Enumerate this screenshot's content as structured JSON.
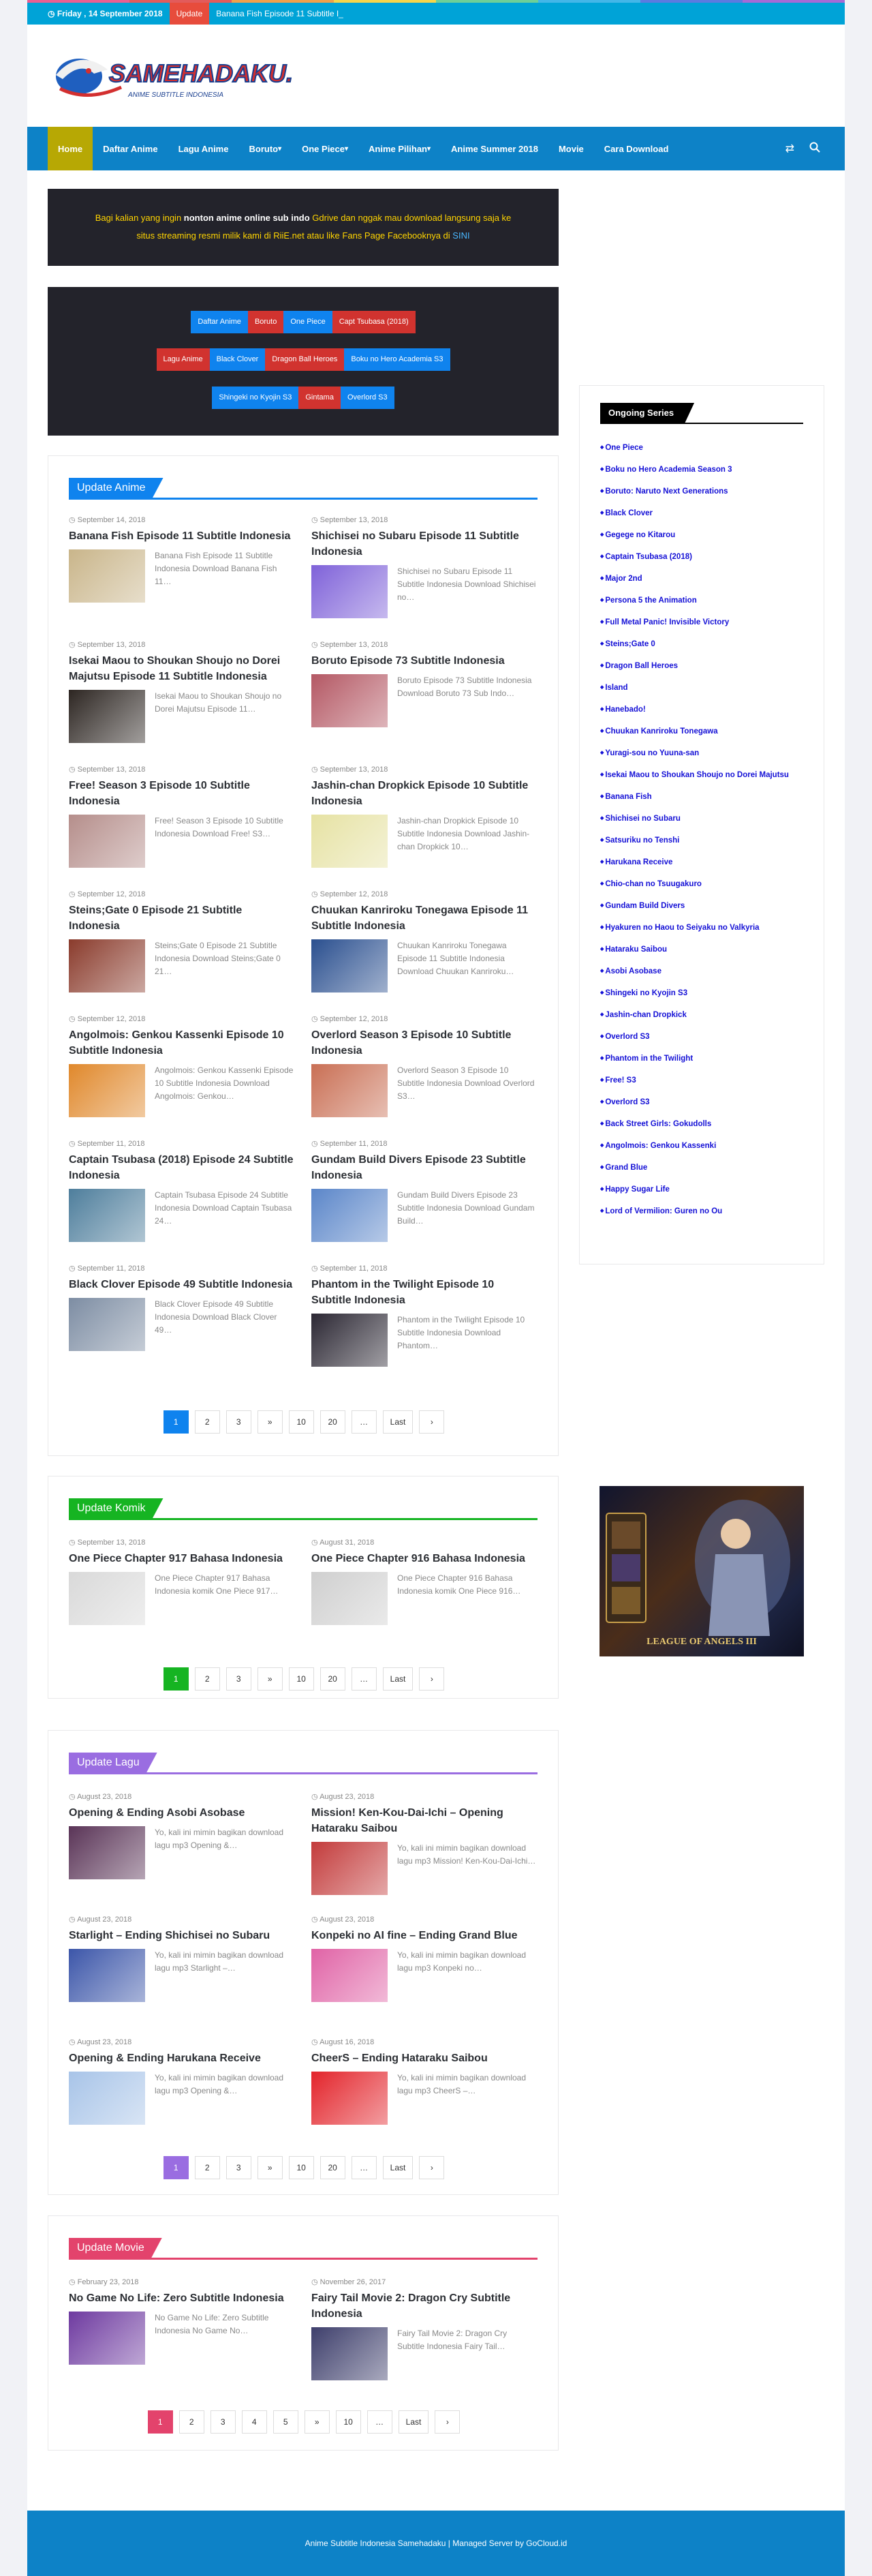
{
  "topbar": {
    "date": "Friday , 14 September 2018",
    "update_label": "Update",
    "ticker": "Banana Fish Episode 11 Subtitle I_"
  },
  "logo": {
    "text": "SAMEHADAKU.TV",
    "tagline": "ANIME SUBTITLE INDONESIA"
  },
  "nav": {
    "items": [
      "Home",
      "Daftar Anime",
      "Lagu Anime",
      "Boruto",
      "One Piece",
      "Anime Pilihan",
      "Anime Summer 2018",
      "Movie",
      "Cara Download"
    ],
    "dropdown": [
      false,
      false,
      false,
      true,
      true,
      true,
      false,
      false,
      false
    ]
  },
  "notice": {
    "line1_pre": "Bagi kalian yang ingin ",
    "line1_bold": "nonton anime online sub indo",
    "line1_post": " Gdrive dan nggak mau download langsung saja ke",
    "line2_pre": "situs streaming resmi milik kami di RiiE.net atau like Fans Page Facebooknya di ",
    "line2_link": "SINI"
  },
  "quick_links": [
    [
      {
        "label": "Daftar Anime",
        "c": "blue"
      },
      {
        "label": "Boruto",
        "c": "red"
      },
      {
        "label": "One Piece",
        "c": "blue"
      },
      {
        "label": "Capt Tsubasa (2018)",
        "c": "red"
      }
    ],
    [
      {
        "label": "Lagu Anime",
        "c": "red"
      },
      {
        "label": "Black Clover",
        "c": "blue"
      },
      {
        "label": "Dragon Ball Heroes",
        "c": "red"
      },
      {
        "label": "Boku no Hero Academia S3",
        "c": "blue"
      }
    ],
    [
      {
        "label": "Shingeki no Kyojin S3",
        "c": "blue"
      },
      {
        "label": "Gintama",
        "c": "red"
      },
      {
        "label": "Overlord S3",
        "c": "blue"
      }
    ]
  ],
  "sections": {
    "anime": {
      "title": "Update Anime",
      "color": "#0f83ee",
      "posts": [
        {
          "date": "September 14, 2018",
          "title": "Banana Fish Episode 11 Subtitle Indonesia",
          "excerpt": "Banana Fish Episode 11 Subtitle Indonesia Download Banana Fish 11…",
          "thumb": "#c9b58a"
        },
        {
          "date": "September 13, 2018",
          "title": "Shichisei no Subaru Episode 11 Subtitle Indonesia",
          "excerpt": "Shichisei no Subaru Episode 11 Subtitle Indonesia Download Shichisei no…",
          "thumb": "#7f62d9"
        },
        {
          "date": "September 13, 2018",
          "title": "Isekai Maou to Shoukan Shoujo no Dorei Majutsu Episode 11 Subtitle Indonesia",
          "excerpt": "Isekai Maou to Shoukan Shoujo no Dorei Majutsu Episode 11…",
          "thumb": "#2d2622"
        },
        {
          "date": "September 13, 2018",
          "title": "Boruto Episode 73 Subtitle Indonesia",
          "excerpt": "Boruto Episode 73 Subtitle Indonesia Download Boruto 73 Sub Indo…",
          "thumb": "#b45864"
        },
        {
          "date": "September 13, 2018",
          "title": "Free! Season 3 Episode 10 Subtitle Indonesia",
          "excerpt": "Free! Season 3 Episode 10 Subtitle Indonesia Download Free! S3…",
          "thumb": "#b58e8b"
        },
        {
          "date": "September 13, 2018",
          "title": "Jashin-chan Dropkick Episode 10 Subtitle Indonesia",
          "excerpt": "Jashin-chan Dropkick Episode 10 Subtitle Indonesia Download Jashin-chan Dropkick 10…",
          "thumb": "#e6e2a3"
        },
        {
          "date": "September 12, 2018",
          "title": "Steins;Gate 0 Episode 21 Subtitle Indonesia",
          "excerpt": "Steins;Gate 0 Episode 21 Subtitle Indonesia Download Steins;Gate 0 21…",
          "thumb": "#8a3b2c"
        },
        {
          "date": "September 12, 2018",
          "title": "Chuukan Kanriroku Tonegawa Episode 11 Subtitle Indonesia",
          "excerpt": "Chuukan Kanriroku Tonegawa Episode 11 Subtitle Indonesia Download Chuukan Kanriroku…",
          "thumb": "#2a4f8f"
        },
        {
          "date": "September 12, 2018",
          "title": "Angolmois: Genkou Kassenki Episode 10 Subtitle Indonesia",
          "excerpt": "Angolmois: Genkou Kassenki Episode 10 Subtitle Indonesia Download Angolmois: Genkou…",
          "thumb": "#e0882b"
        },
        {
          "date": "September 12, 2018",
          "title": "Overlord Season 3 Episode 10 Subtitle Indonesia",
          "excerpt": "Overlord Season 3 Episode 10 Subtitle Indonesia Download Overlord S3…",
          "thumb": "#c96f54"
        },
        {
          "date": "September 11, 2018",
          "title": "Captain Tsubasa (2018) Episode 24 Subtitle Indonesia",
          "excerpt": "Captain Tsubasa Episode 24 Subtitle Indonesia Download Captain Tsubasa 24…",
          "thumb": "#4e7e9c"
        },
        {
          "date": "September 11, 2018",
          "title": "Gundam Build Divers Episode 23 Subtitle Indonesia",
          "excerpt": "Gundam Build Divers Episode 23 Subtitle Indonesia Download Gundam Build…",
          "thumb": "#5b86c9"
        },
        {
          "date": "September 11, 2018",
          "title": "Black Clover Episode 49 Subtitle Indonesia",
          "excerpt": "Black Clover Episode 49 Subtitle Indonesia Download Black Clover 49…",
          "thumb": "#7d8da3"
        },
        {
          "date": "September 11, 2018",
          "title": "Phantom in the Twilight Episode 10 Subtitle Indonesia",
          "excerpt": "Phantom in the Twilight Episode 10 Subtitle Indonesia Download Phantom…",
          "thumb": "#2b2733"
        }
      ],
      "pager": [
        "1",
        "2",
        "3",
        "»",
        "10",
        "20",
        "…",
        "Last",
        "›"
      ]
    },
    "komik": {
      "title": "Update Komik",
      "color": "#16b422",
      "posts": [
        {
          "date": "September 13, 2018",
          "title": "One Piece Chapter 917 Bahasa Indonesia",
          "excerpt": "One Piece Chapter 917 Bahasa Indonesia komik One Piece 917…",
          "thumb": "#d9d9d9"
        },
        {
          "date": "August 31, 2018",
          "title": "One Piece Chapter 916 Bahasa Indonesia",
          "excerpt": "One Piece Chapter 916 Bahasa Indonesia komik One Piece 916…",
          "thumb": "#cfcfcf"
        }
      ],
      "pager": [
        "1",
        "2",
        "3",
        "»",
        "10",
        "20",
        "…",
        "Last",
        "›"
      ]
    },
    "lagu": {
      "title": "Update Lagu",
      "color": "#9a6de1",
      "posts": [
        {
          "date": "August 23, 2018",
          "title": "Opening & Ending Asobi Asobase",
          "excerpt": "Yo, kali ini mimin bagikan download lagu mp3 Opening &…",
          "thumb": "#5a3457"
        },
        {
          "date": "August 23, 2018",
          "title": "Mission! Ken-Kou-Dai-Ichi – Opening Hataraku Saibou",
          "excerpt": "Yo, kali ini mimin bagikan download lagu mp3 Mission! Ken-Kou-Dai-Ichi…",
          "thumb": "#c33b3b"
        },
        {
          "date": "August 23, 2018",
          "title": "Starlight – Ending Shichisei no Subaru",
          "excerpt": "Yo, kali ini mimin bagikan download lagu mp3 Starlight –…",
          "thumb": "#3c56a9"
        },
        {
          "date": "August 23, 2018",
          "title": "Konpeki no AI fine – Ending Grand Blue",
          "excerpt": "Yo, kali ini mimin bagikan download lagu mp3 Konpeki no…",
          "thumb": "#e063a6"
        },
        {
          "date": "August 23, 2018",
          "title": "Opening & Ending Harukana Receive",
          "excerpt": "Yo, kali ini mimin bagikan download lagu mp3 Opening &…",
          "thumb": "#a8c4e8"
        },
        {
          "date": "August 16, 2018",
          "title": "CheerS – Ending Hataraku Saibou",
          "excerpt": "Yo, kali ini mimin bagikan download lagu mp3 CheerS –…",
          "thumb": "#e3242b"
        }
      ],
      "pager": [
        "1",
        "2",
        "3",
        "»",
        "10",
        "20",
        "…",
        "Last",
        "›"
      ]
    },
    "movie": {
      "title": "Update Movie",
      "color": "#e3436c",
      "posts": [
        {
          "date": "February 23, 2018",
          "title": "No Game No Life: Zero Subtitle Indonesia",
          "excerpt": "No Game No Life: Zero Subtitle Indonesia No Game No…",
          "thumb": "#6e3aa0"
        },
        {
          "date": "November 26, 2017",
          "title": "Fairy Tail Movie 2: Dragon Cry Subtitle Indonesia",
          "excerpt": "Fairy Tail Movie 2: Dragon Cry Subtitle Indonesia Fairy Tail…",
          "thumb": "#3e3f6c"
        }
      ],
      "pager": [
        "1",
        "2",
        "3",
        "4",
        "5",
        "»",
        "10",
        "…",
        "Last",
        "›"
      ]
    }
  },
  "sidebar": {
    "title": "Ongoing Series",
    "items": [
      "One Piece",
      "Boku no Hero Academia Season 3",
      "Boruto: Naruto Next Generations",
      "Black Clover",
      "Gegege no Kitarou",
      "Captain Tsubasa (2018)",
      "Major 2nd",
      "Persona 5 the Animation",
      "Full Metal Panic! Invisible Victory",
      "Steins;Gate 0",
      "Dragon Ball Heroes",
      "Island",
      "Hanebado!",
      "Chuukan Kanriroku Tonegawa",
      "Yuragi-sou no Yuuna-san",
      "Isekai Maou to Shoukan Shoujo no Dorei Majutsu",
      "Banana Fish",
      "Shichisei no Subaru",
      "Satsuriku no Tenshi",
      "Harukana Receive",
      "Chio-chan no Tsuugakuro",
      "Gundam Build Divers",
      "Hyakuren no Haou to Seiyaku no Valkyria",
      "Hataraku Saibou",
      "Asobi Asobase",
      "Shingeki no Kyojin S3",
      "Jashin-chan Dropkick",
      "Overlord S3",
      "Phantom in the Twilight",
      "Free! S3",
      "Overlord S3",
      "Back Street Girls: Gokudolls",
      "Angolmois: Genkou Kassenki",
      "Grand Blue",
      "Happy Sugar Life",
      "Lord of Vermilion: Guren no Ou"
    ]
  },
  "ad": {
    "text": "LEAGUE OF ANGELS III"
  },
  "footer": {
    "text": "Anime Subtitle Indonesia Samehadaku | Managed Server by GoCloud.id"
  },
  "colors": {
    "nav": "#0d82c7",
    "topbar": "#00a3d7",
    "home_active": "#b7a804",
    "footer": "#0d82c7",
    "rainbow": [
      "#eb5f91",
      "#e25b5b",
      "#f0a04b",
      "#f6d54a",
      "#6fcf97",
      "#43b6e8",
      "#5c7be0",
      "#a66ad6"
    ]
  }
}
